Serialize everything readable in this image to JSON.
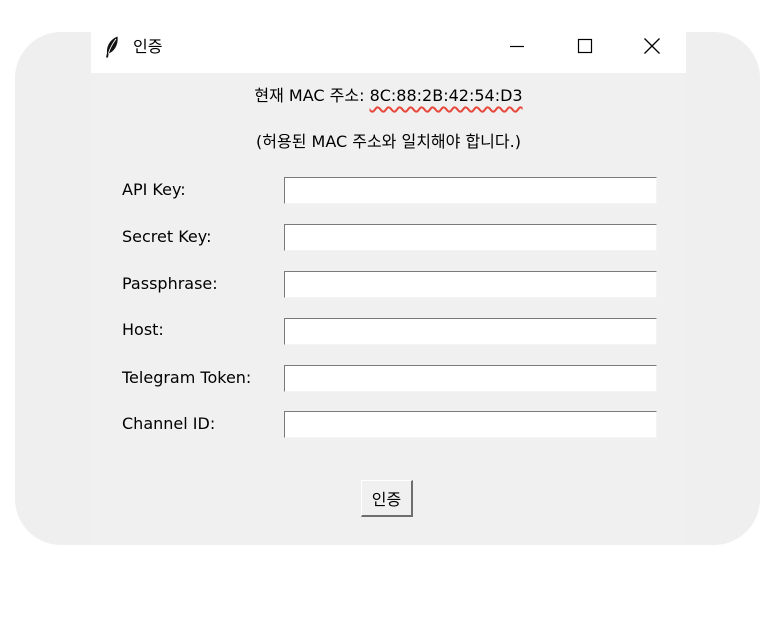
{
  "window": {
    "title": "인증",
    "controls": {
      "minimize": "minimize-icon",
      "maximize": "maximize-icon",
      "close": "close-icon"
    }
  },
  "info": {
    "mac_prefix": "현재 MAC 주소: ",
    "mac_address": "8C:88:2B:42:54:D3",
    "hint": "(허용된 MAC 주소와 일치해야 합니다.)"
  },
  "fields": [
    {
      "label": "API Key:",
      "value": ""
    },
    {
      "label": "Secret Key:",
      "value": ""
    },
    {
      "label": "Passphrase:",
      "value": ""
    },
    {
      "label": "Host:",
      "value": ""
    },
    {
      "label": "Telegram Token:",
      "value": ""
    },
    {
      "label": "Channel ID:",
      "value": ""
    }
  ],
  "submit": {
    "label": "인증"
  },
  "colors": {
    "window_bg": "#f0f0f0",
    "titlebar_bg": "#ffffff",
    "spellcheck_underline": "#e8483c"
  }
}
